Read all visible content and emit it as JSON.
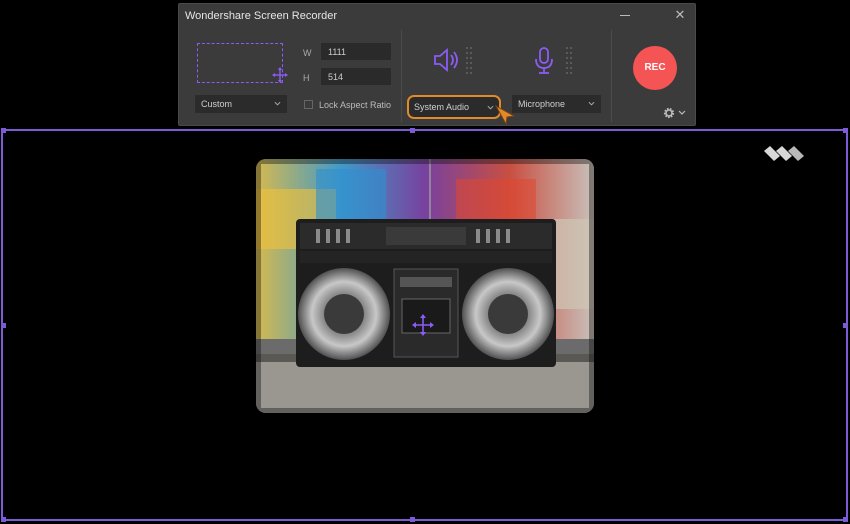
{
  "window": {
    "title": "Wondershare Screen Recorder",
    "close_glyph": "✕"
  },
  "area": {
    "width_label": "W",
    "width_value": "1111",
    "height_label": "H",
    "height_value": "514",
    "preset": "Custom"
  },
  "lock_aspect_ratio": {
    "label": "Lock Aspect Ratio",
    "checked": false
  },
  "audio": {
    "system_audio": "System Audio",
    "microphone": "Microphone"
  },
  "rec_button": {
    "label": "REC"
  },
  "settings": {
    "icon": "gear-icon"
  },
  "colors": {
    "accent": "#8b5cf6",
    "rec": "#f45454",
    "highlight": "#e08a2c",
    "panel_bg": "#3b3b3b"
  }
}
